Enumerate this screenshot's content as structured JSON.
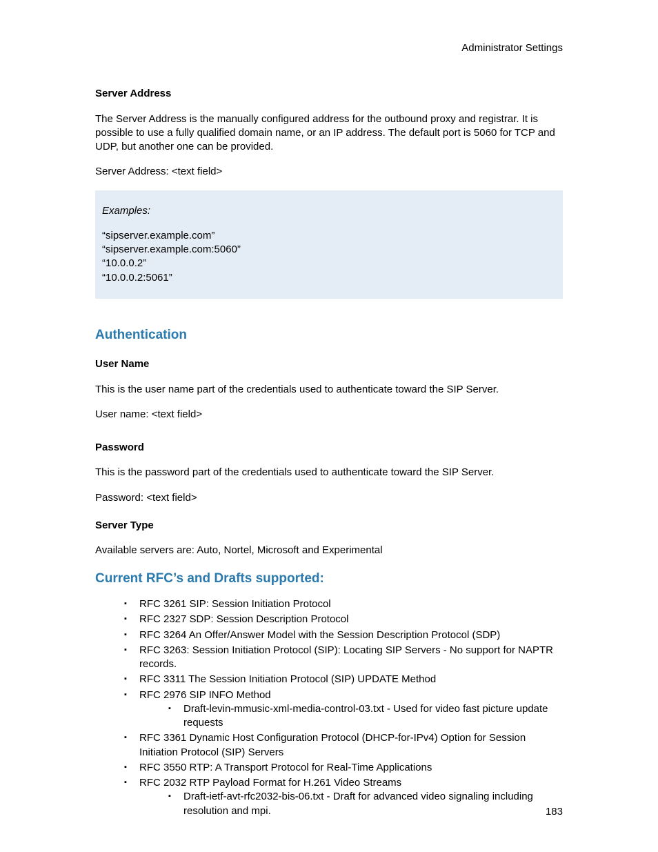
{
  "header": {
    "right": "Administrator Settings"
  },
  "serverAddress": {
    "title": "Server Address",
    "desc": "The Server Address is the manually configured address for the outbound proxy and registrar. It is possible to use a fully qualified domain name, or an IP address. The default port is 5060 for TCP and UDP, but another one can be provided.",
    "field": "Server Address:  <text field>"
  },
  "examples": {
    "title": "Examples:",
    "lines": [
      "“sipserver.example.com”",
      "“sipserver.example.com:5060”",
      "“10.0.0.2”",
      "“10.0.0.2:5061”"
    ]
  },
  "auth": {
    "heading": "Authentication",
    "username": {
      "title": "User Name",
      "desc": "This is the user name part of the credentials used to authenticate toward the SIP Server.",
      "field": "User name: <text field>"
    },
    "password": {
      "title": "Password",
      "desc": "This is the password part of the credentials used to authenticate toward the SIP Server.",
      "field": "Password: <text field>"
    },
    "serverType": {
      "title": "Server Type",
      "desc": "Available servers are: Auto, Nortel, Microsoft and Experimental"
    }
  },
  "rfc": {
    "heading": "Current RFC’s and Drafts supported:",
    "items": [
      "RFC 3261 SIP: Session Initiation Protocol",
      "RFC 2327 SDP: Session Description Protocol",
      "RFC 3264 An Offer/Answer Model with the Session Description Protocol (SDP)",
      "RFC 3263: Session Initiation Protocol (SIP): Locating SIP Servers - No support for NAPTR records.",
      "RFC 3311 The Session Initiation Protocol (SIP) UPDATE Method",
      "RFC 2976 SIP INFO Method",
      "RFC 3361 Dynamic Host Configuration Protocol (DHCP-for-IPv4) Option for Session Initiation Protocol (SIP) Servers",
      "RFC 3550 RTP: A Transport Protocol for Real-Time Applications",
      "RFC 2032 RTP Payload Format for H.261 Video Streams"
    ],
    "sub6": "Draft-levin-mmusic-xml-media-control-03.txt - Used for video fast picture update requests",
    "sub9": "Draft-ietf-avt-rfc2032-bis-06.txt - Draft for advanced video signaling including resolution and mpi."
  },
  "pageNumber": "183"
}
